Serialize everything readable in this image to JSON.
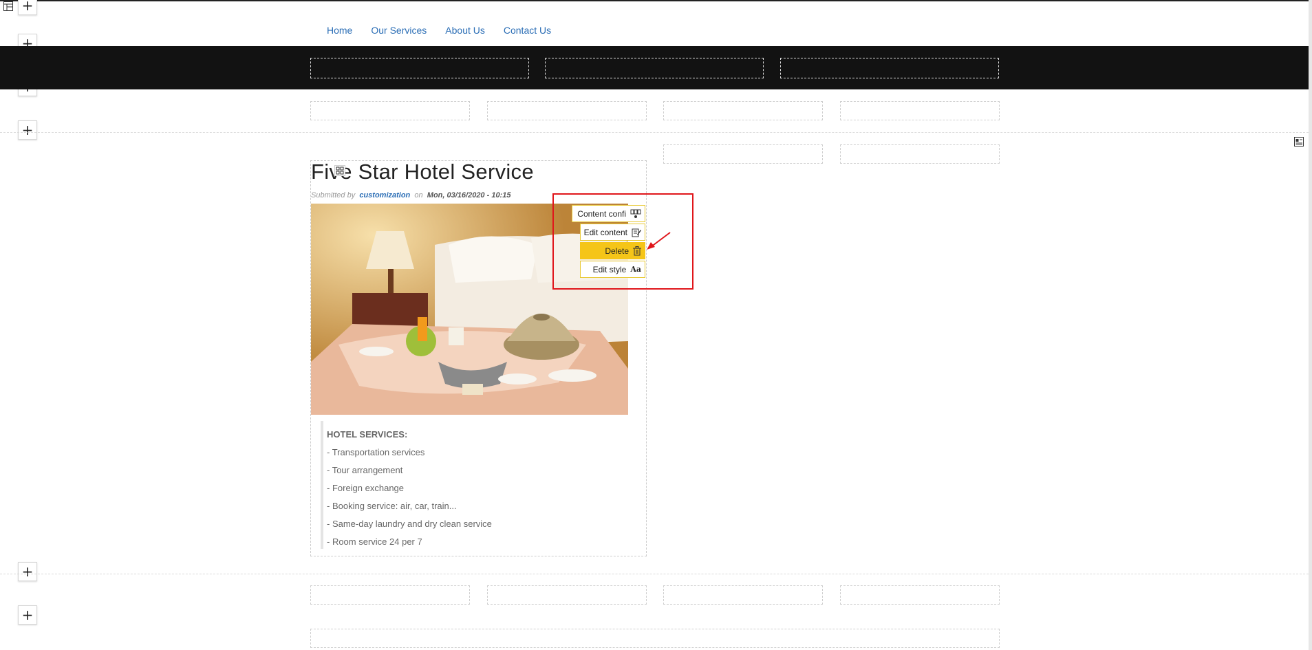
{
  "nav": {
    "items": [
      "Home",
      "Our Services",
      "About Us",
      "Contact Us"
    ]
  },
  "article": {
    "title": "Five Star Hotel Service",
    "meta": {
      "submitted_by": "Submitted by",
      "author": "customization",
      "on": "on",
      "date": "Mon, 03/16/2020 - 10:15"
    },
    "body": {
      "heading": "HOTEL SERVICES:",
      "items": [
        "- Transportation services",
        "- Tour arrangement",
        "- Foreign exchange",
        "- Booking service: air, car, train...",
        "- Same-day laundry and dry clean service",
        "- Room service 24 per 7"
      ]
    }
  },
  "context_menu": {
    "content_config": "Content confi",
    "edit_content": "Edit content",
    "delete": "Delete",
    "edit_style": "Edit style",
    "style_glyph": "Aa"
  },
  "add_buttons": {
    "glyph": "+"
  },
  "colors": {
    "link": "#2a6db5",
    "highlight": "#f5c518",
    "annotation": "#e0161b",
    "black_band": "#121212"
  }
}
